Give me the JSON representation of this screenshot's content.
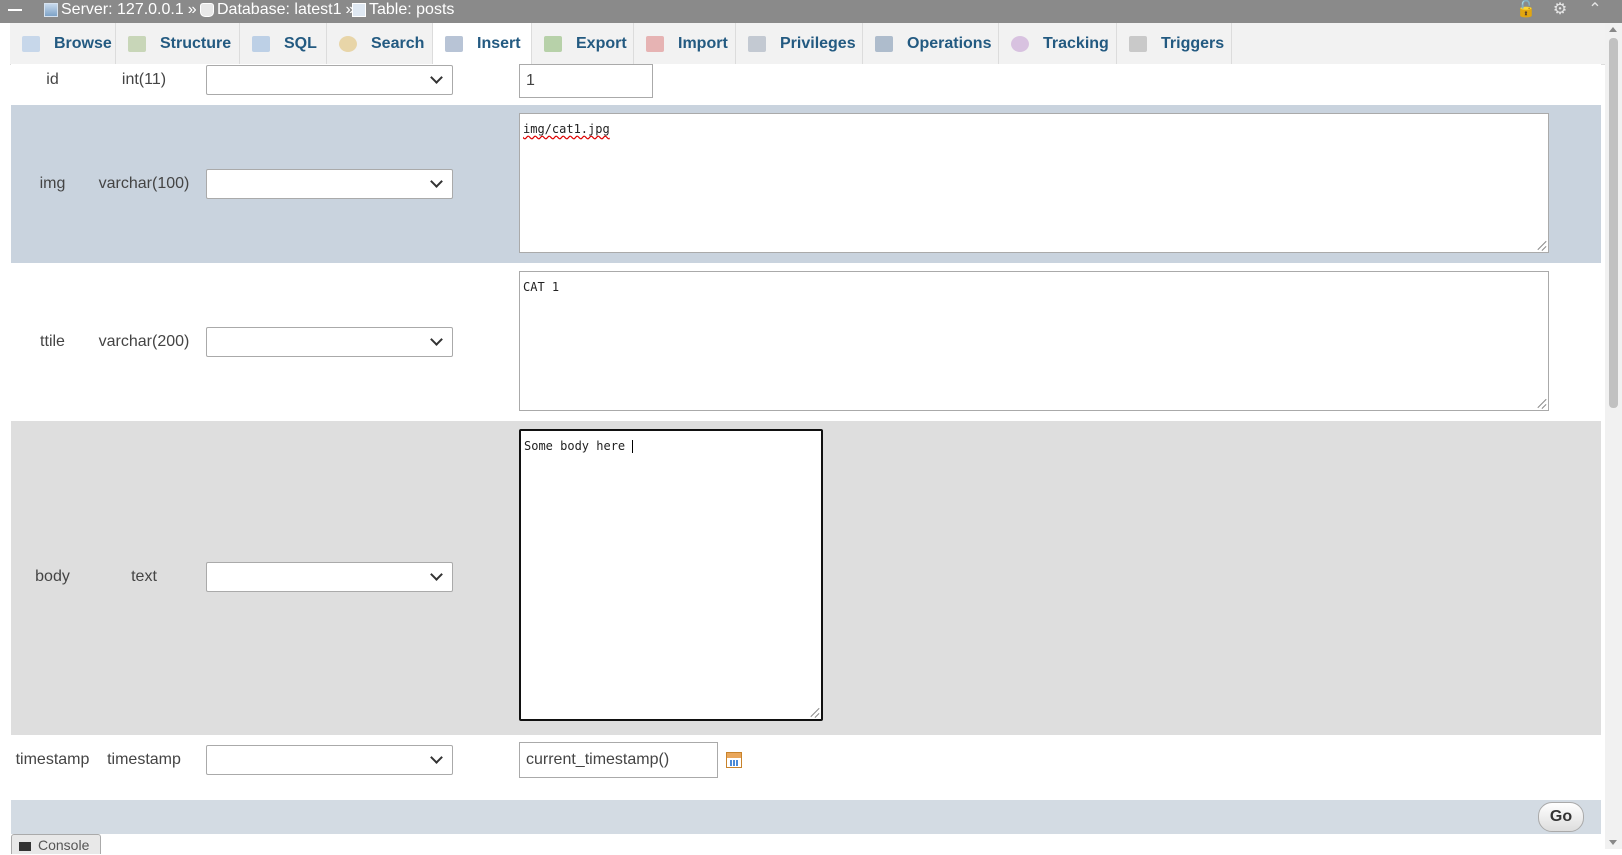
{
  "breadcrumb": {
    "server_label": "Server: 127.0.0.1",
    "db_label": "Database: latest1",
    "table_label": "Table: posts",
    "sep": "»"
  },
  "tabs": [
    {
      "label": "Browse",
      "icon": "browse-icon"
    },
    {
      "label": "Structure",
      "icon": "structure-icon"
    },
    {
      "label": "SQL",
      "icon": "sql-icon"
    },
    {
      "label": "Search",
      "icon": "search-icon"
    },
    {
      "label": "Insert",
      "icon": "insert-icon",
      "active": true
    },
    {
      "label": "Export",
      "icon": "export-icon"
    },
    {
      "label": "Import",
      "icon": "import-icon"
    },
    {
      "label": "Privileges",
      "icon": "privileges-icon"
    },
    {
      "label": "Operations",
      "icon": "operations-icon"
    },
    {
      "label": "Tracking",
      "icon": "tracking-icon"
    },
    {
      "label": "Triggers",
      "icon": "triggers-icon"
    }
  ],
  "fields": [
    {
      "name": "id",
      "type": "int(11)",
      "function": "",
      "value": "1"
    },
    {
      "name": "img",
      "type": "varchar(100)",
      "function": "",
      "value": "img/cat1.jpg"
    },
    {
      "name": "ttile",
      "type": "varchar(200)",
      "function": "",
      "value": "CAT 1"
    },
    {
      "name": "body",
      "type": "text",
      "function": "",
      "value": "Some body here "
    },
    {
      "name": "timestamp",
      "type": "timestamp",
      "function": "",
      "value": "current_timestamp()"
    }
  ],
  "go_label": "Go",
  "console_label": "Console",
  "colors": {
    "breadcrumb_bg": "#8a8a8a",
    "row_highlight": "#c9d3de",
    "row_alt": "#dedede",
    "footer_bar": "#d3dbe3",
    "tab_text": "#235a81"
  }
}
